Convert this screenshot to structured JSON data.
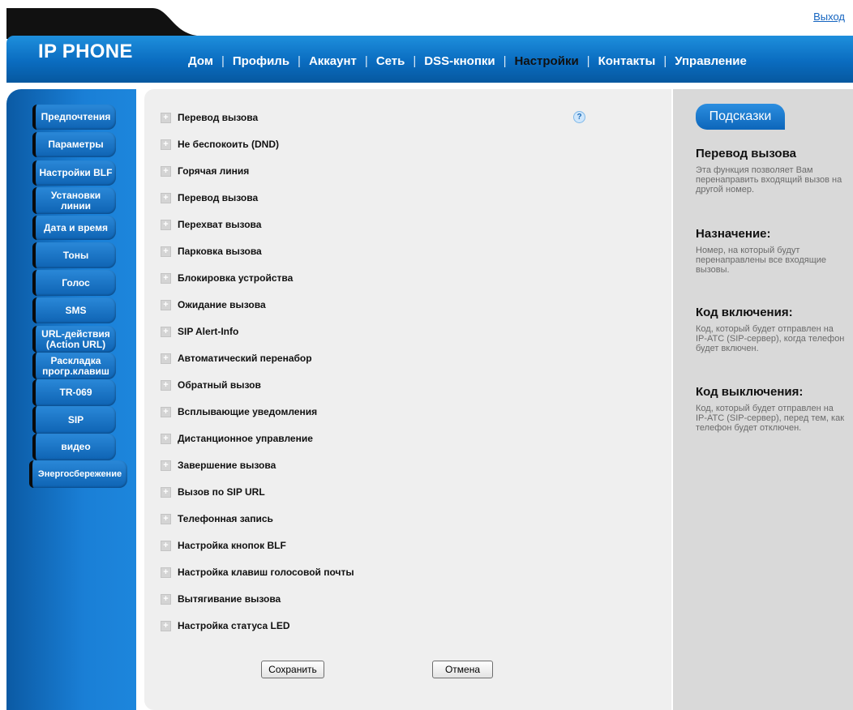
{
  "header": {
    "logout": "Выход",
    "brand": "IP PHONE",
    "nav": [
      {
        "label": "Дом",
        "active": false
      },
      {
        "label": "Профиль",
        "active": false
      },
      {
        "label": "Аккаунт",
        "active": false
      },
      {
        "label": "Сеть",
        "active": false
      },
      {
        "label": "DSS-кнопки",
        "active": false
      },
      {
        "label": "Настройки",
        "active": true
      },
      {
        "label": "Контакты",
        "active": false
      },
      {
        "label": "Управление",
        "active": false
      }
    ],
    "separator": "|"
  },
  "sidebar": {
    "items": [
      {
        "label": "Предпочтения"
      },
      {
        "label": "Параметры"
      },
      {
        "label": "Настройки BLF"
      },
      {
        "label": "Установки\nлинии"
      },
      {
        "label": "Дата и время"
      },
      {
        "label": "Тоны"
      },
      {
        "label": "Голос"
      },
      {
        "label": "SMS"
      },
      {
        "label": "URL-действия\n(Action URL)"
      },
      {
        "label": "Раскладка\nпрогр.клавиш"
      },
      {
        "label": "TR-069"
      },
      {
        "label": "SIP"
      },
      {
        "label": "видео"
      },
      {
        "label": "Энергосбережение"
      }
    ]
  },
  "main": {
    "help_icon": "?",
    "expand_icon": "+",
    "sections": [
      "Перевод вызова",
      "Не беспокоить (DND)",
      "Горячая линия",
      "Перевод вызова",
      "Перехват вызова",
      "Парковка вызова",
      "Блокировка устройства",
      "Ожидание вызова",
      "SIP Alert-Info",
      "Автоматический перенабор",
      "Обратный вызов",
      "Всплывающие уведомления",
      "Дистанционное управление",
      "Завершение вызова",
      "Вызов по SIP URL",
      "Телефонная запись",
      "Настройка кнопок BLF",
      "Настройка клавиш голосовой почты",
      "Вытягивание вызова",
      "Настройка статуса LED"
    ],
    "save_label": "Сохранить",
    "cancel_label": "Отмена"
  },
  "hints": {
    "tab": "Подсказки",
    "blocks": [
      {
        "title": "Перевод вызова",
        "text": "Эта функция позволяет Вам\nперенаправить входящий вызов на\nдругой номер."
      },
      {
        "title": "Назначение:",
        "text": "Номер, на который будут\nперенаправлены все входящие\nвызовы."
      },
      {
        "title": "Код включения:",
        "text": "Код, который будет отправлен на\nIP-АТС (SIP-сервер), когда телефон\nбудет включен."
      },
      {
        "title": "Код выключения:",
        "text": "Код, который будет отправлен на\nIP-АТС (SIP-сервер), перед тем, как\nтелефон будет отключен."
      }
    ]
  },
  "colors": {
    "accent": "#0a6cc0",
    "panel": "#efefef",
    "hints_bg": "#d9d9d9"
  }
}
